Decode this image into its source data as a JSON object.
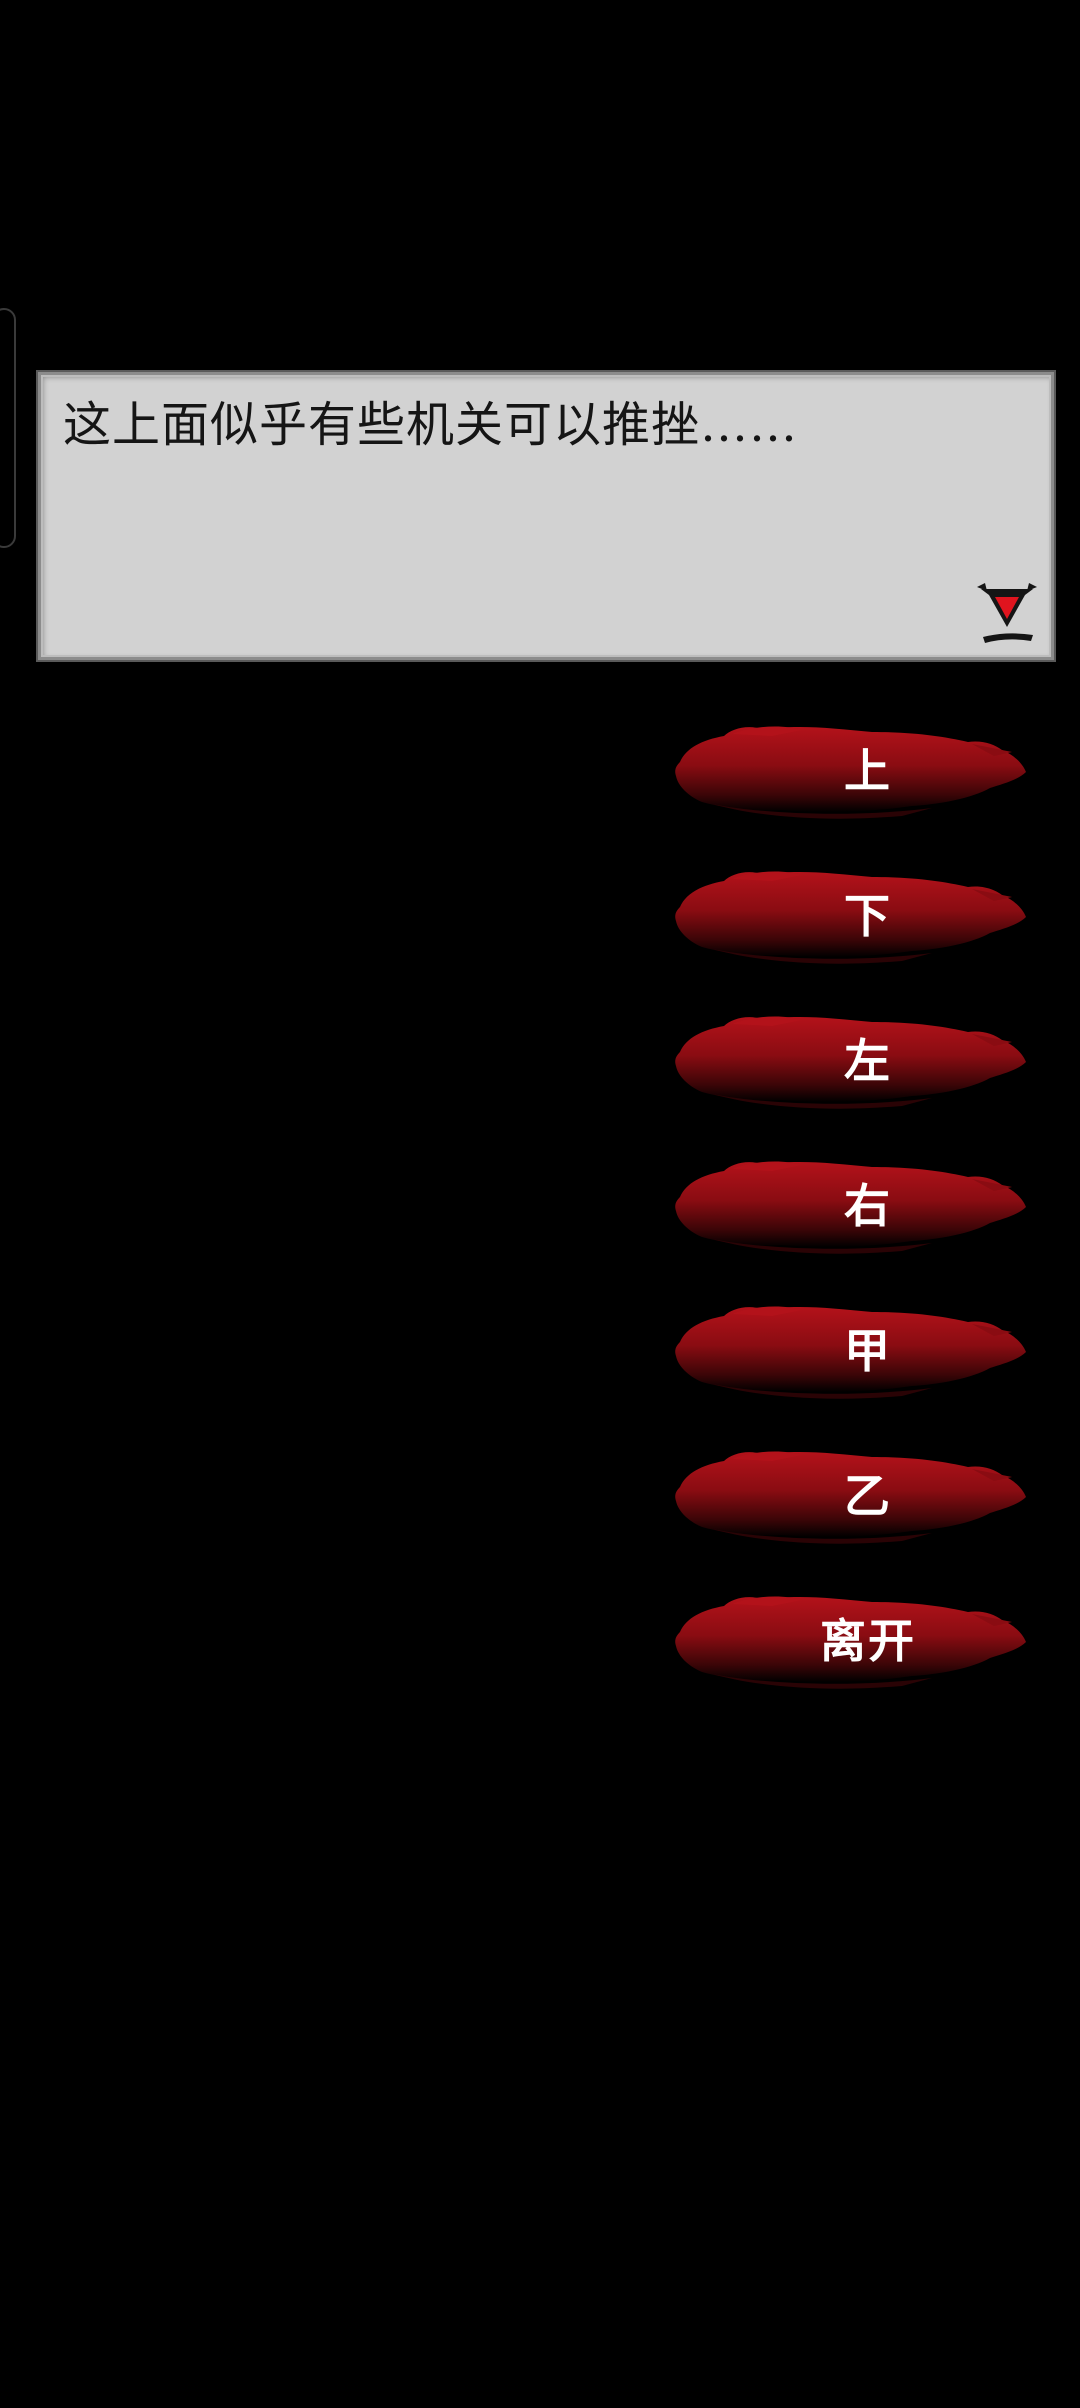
{
  "dialog": {
    "text": "这上面似乎有些机关可以推挫……",
    "advance_icon": "advance-triangle-icon"
  },
  "choices": [
    {
      "label": "上"
    },
    {
      "label": "下"
    },
    {
      "label": "左"
    },
    {
      "label": "右"
    },
    {
      "label": "甲"
    },
    {
      "label": "乙"
    },
    {
      "label": "离开"
    }
  ],
  "colors": {
    "background": "#000000",
    "dialog_bg": "#d2d2d2",
    "brush_red": "#a50f14",
    "accent_red": "#e0141e",
    "text_dark": "#151515",
    "text_light": "#ffffff"
  }
}
